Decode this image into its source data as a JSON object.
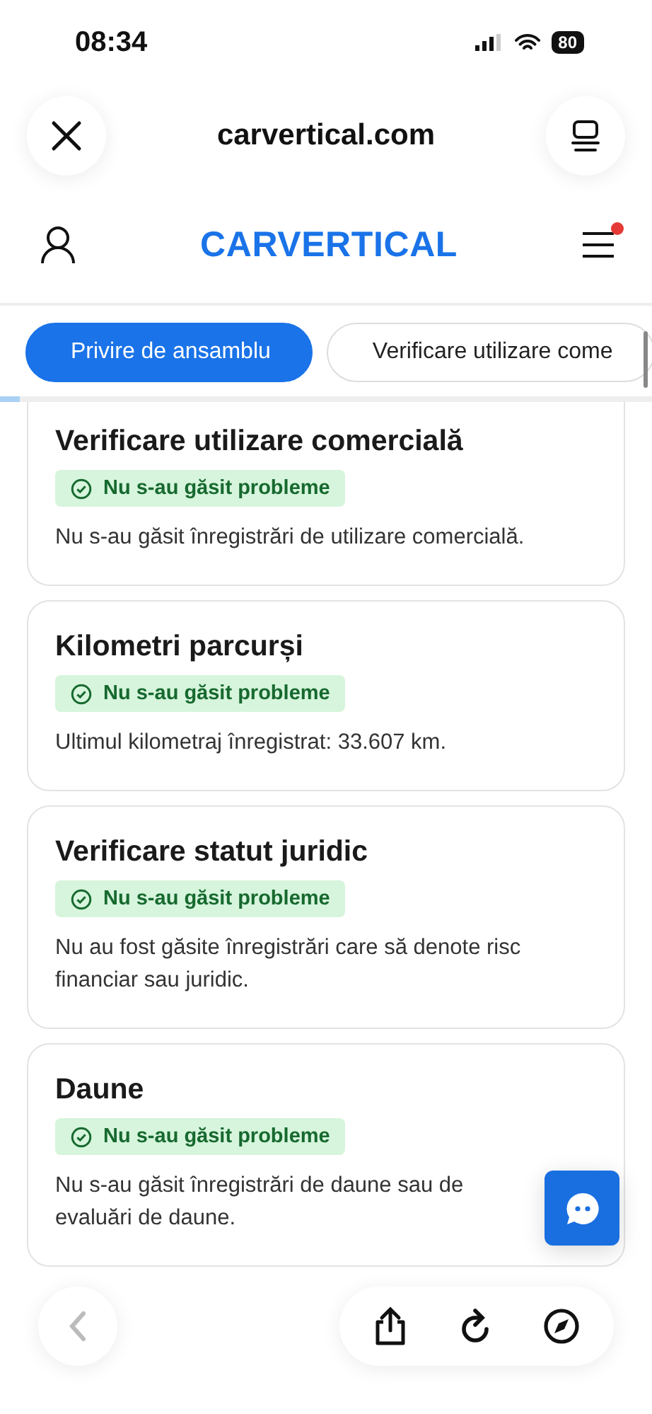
{
  "status_bar": {
    "time": "08:34",
    "battery": "80"
  },
  "browser_bar": {
    "url": "carvertical.com"
  },
  "site_header": {
    "logo": "CARVERTICAL",
    "menu_badge": true
  },
  "tabs": [
    {
      "label": "Privire de ansamblu",
      "selected": true
    },
    {
      "label": "Verificare utilizare come",
      "selected": false
    }
  ],
  "reading_progress": {
    "level": 0.03
  },
  "cards": [
    {
      "title": "Verificare utilizare comercială",
      "badge": "Nu s-au găsit probleme",
      "lines": [
        "Nu s-au găsit înregistrări de utilizare comercială."
      ]
    },
    {
      "title": "Kilometri parcurși",
      "badge": "Nu s-au găsit probleme",
      "lines": [
        "Ultimul kilometraj înregistrat: 33.607 km."
      ]
    },
    {
      "title": "Verificare statut juridic",
      "badge": "Nu s-au găsit probleme",
      "lines": [
        "Nu au fost găsite înregistrări care să denote risc",
        "financiar sau juridic."
      ]
    },
    {
      "title": "Daune",
      "badge": "Nu s-au găsit probleme",
      "lines": [
        "Nu s-au găsit înregistrări de daune sau de",
        "evaluări de daune."
      ]
    }
  ],
  "toolbar": {
    "back_disabled": true
  }
}
